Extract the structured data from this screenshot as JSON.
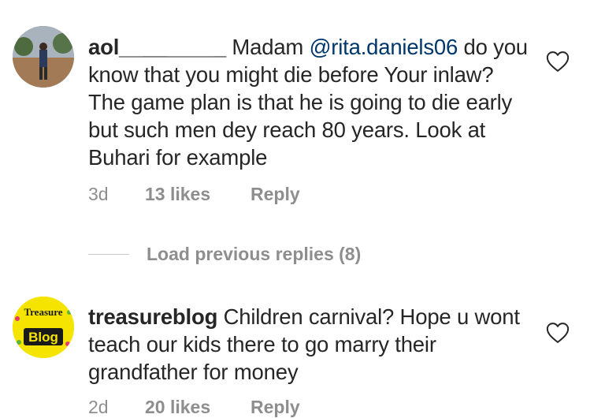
{
  "comments": [
    {
      "username": "aol_________",
      "text_before": " Madam ",
      "mention": "@rita.daniels06",
      "text_after": " do you know that you might die before Your inlaw? The game plan is that he is going to die early but such men dey reach 80 years. Look at Buhari for example",
      "age": "3d",
      "likes": "13 likes",
      "reply_label": "Reply"
    },
    {
      "username": "treasureblog",
      "text": " Children carnival? Hope u wont teach our kids there to go marry their grandfather for money",
      "age": "2d",
      "likes": "20 likes",
      "reply_label": "Reply",
      "avatar_logo": [
        "Treasure",
        "Blog"
      ]
    }
  ],
  "load_replies": "Load previous replies (8)",
  "icons": {
    "like": "heart-outline-icon"
  },
  "colors": {
    "mention": "#00376b",
    "meta": "#8e8e8e",
    "logo_bg": "#f5e400"
  }
}
